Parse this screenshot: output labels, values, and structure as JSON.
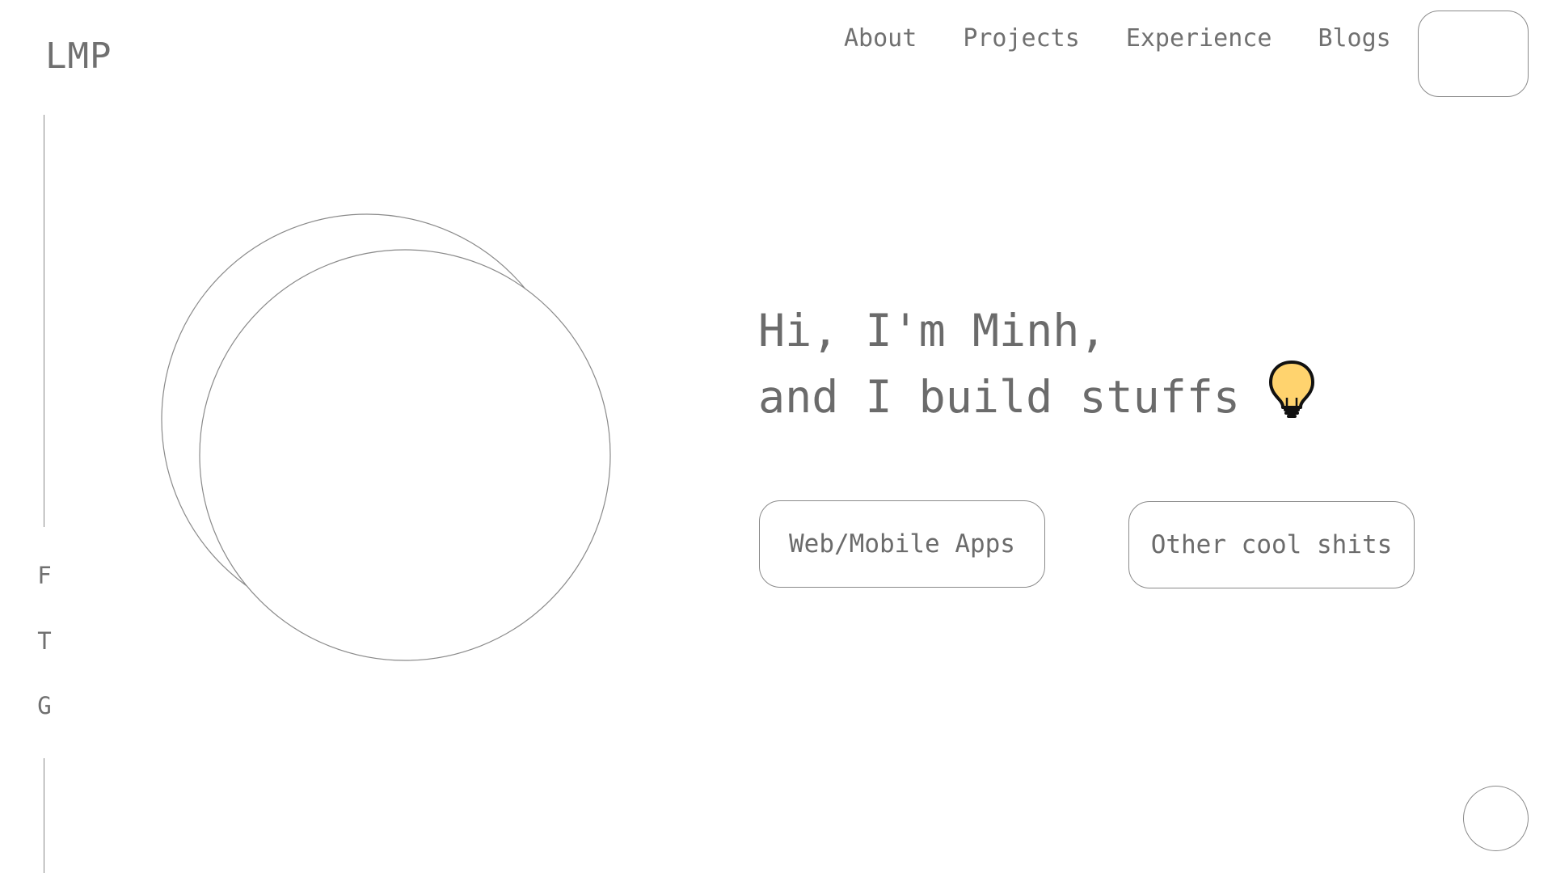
{
  "logo": {
    "text": "LMP"
  },
  "nav": {
    "items": [
      {
        "label": "About"
      },
      {
        "label": "Projects"
      },
      {
        "label": "Experience"
      },
      {
        "label": "Blogs"
      }
    ]
  },
  "social": {
    "items": [
      {
        "label": "F"
      },
      {
        "label": "T"
      },
      {
        "label": "G"
      }
    ]
  },
  "hero": {
    "line1": "Hi, I'm Minh,",
    "line2": "and I build stuffs",
    "emoji_icon": "lightbulb-icon"
  },
  "cta": {
    "primary_label": "Web/Mobile Apps",
    "secondary_label": "Other cool shits"
  },
  "colors": {
    "text": "#6b6b6b",
    "border": "#8a8a8a",
    "bulb_fill": "#ffd36e",
    "bulb_outline": "#111111"
  }
}
